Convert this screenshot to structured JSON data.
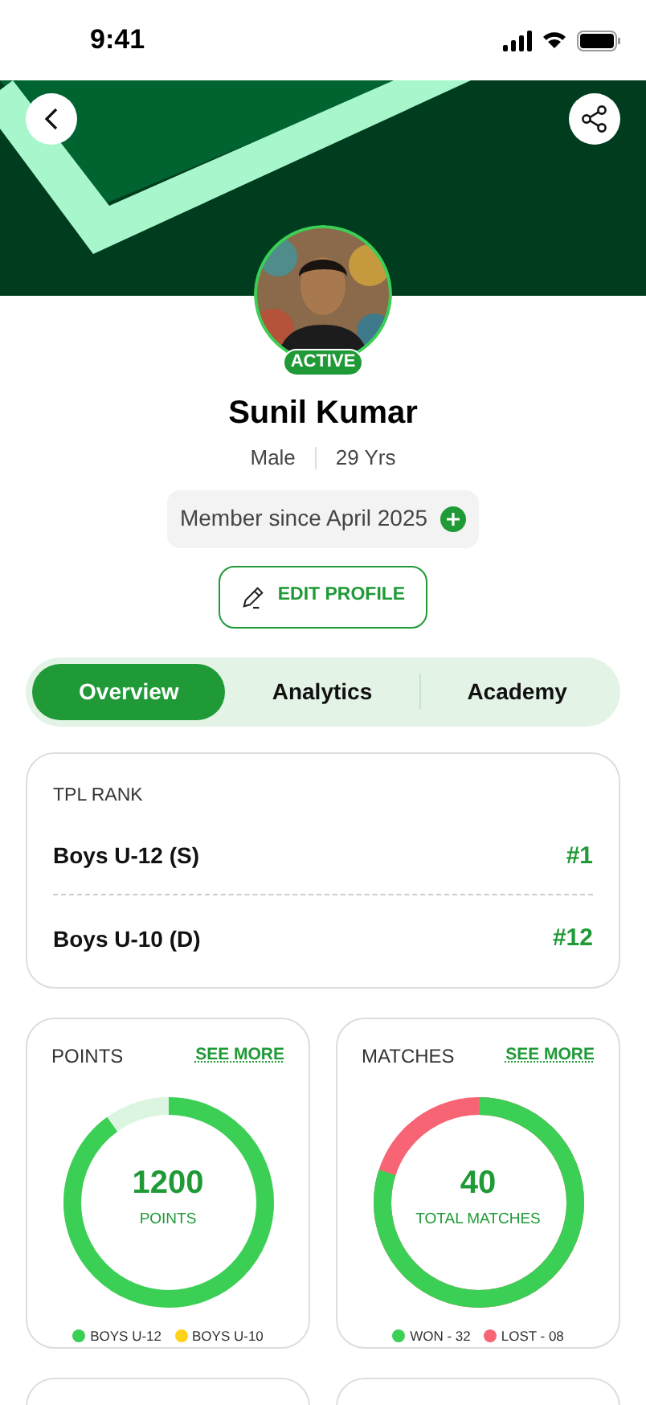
{
  "status_bar": {
    "time": "9:41"
  },
  "profile": {
    "status": "ACTIVE",
    "name": "Sunil Kumar",
    "gender": "Male",
    "age": "29 Yrs",
    "member_since": "Member since April 2025",
    "edit_button": "EDIT PROFILE"
  },
  "tabs": [
    {
      "label": "Overview",
      "selected": true
    },
    {
      "label": "Analytics",
      "selected": false
    },
    {
      "label": "Academy",
      "selected": false
    }
  ],
  "rank_card": {
    "title": "TPL RANK",
    "rows": [
      {
        "category": "Boys U-12 (S)",
        "rank": "#1"
      },
      {
        "category": "Boys U-10 (D)",
        "rank": "#12"
      }
    ]
  },
  "stat_cards": [
    {
      "title": "POINTS",
      "link": "SEE MORE",
      "value": "1200",
      "caption": "POINTS",
      "kind": "points",
      "legend": [
        {
          "label": "BOYS U-12",
          "color": "#3ccf55"
        },
        {
          "label": "BOYS U-10",
          "color": "#ffd21a"
        }
      ]
    },
    {
      "title": "MATCHES",
      "link": "SEE MORE",
      "value": "40",
      "caption": "TOTAL MATCHES",
      "kind": "matches",
      "legend": [
        {
          "label": "WON - 32",
          "color": "#3ccf55"
        },
        {
          "label": "LOST - 08",
          "color": "#f76474"
        }
      ]
    }
  ]
}
